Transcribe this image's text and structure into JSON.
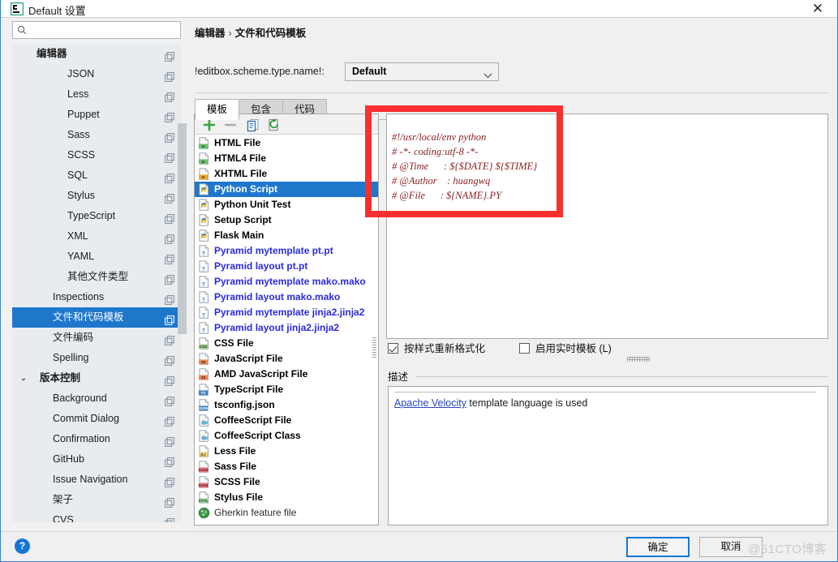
{
  "window": {
    "title": "Default 设置",
    "icon": "pycharm-icon",
    "close_label": "✕"
  },
  "sidebar": {
    "search": {
      "value": "",
      "placeholder": "",
      "icon": "search-icon"
    },
    "items": [
      {
        "label": "编辑器",
        "indent": 30,
        "bold": true,
        "selected": false,
        "caret": ""
      },
      {
        "label": "JSON",
        "indent": 68,
        "bold": false,
        "selected": false,
        "caret": ""
      },
      {
        "label": "Less",
        "indent": 68,
        "bold": false,
        "selected": false,
        "caret": ""
      },
      {
        "label": "Puppet",
        "indent": 68,
        "bold": false,
        "selected": false,
        "caret": ""
      },
      {
        "label": "Sass",
        "indent": 68,
        "bold": false,
        "selected": false,
        "caret": ""
      },
      {
        "label": "SCSS",
        "indent": 68,
        "bold": false,
        "selected": false,
        "caret": ""
      },
      {
        "label": "SQL",
        "indent": 68,
        "bold": false,
        "selected": false,
        "caret": ""
      },
      {
        "label": "Stylus",
        "indent": 68,
        "bold": false,
        "selected": false,
        "caret": ""
      },
      {
        "label": "TypeScript",
        "indent": 68,
        "bold": false,
        "selected": false,
        "caret": ""
      },
      {
        "label": "XML",
        "indent": 68,
        "bold": false,
        "selected": false,
        "caret": ""
      },
      {
        "label": "YAML",
        "indent": 68,
        "bold": false,
        "selected": false,
        "caret": ""
      },
      {
        "label": "其他文件类型",
        "indent": 68,
        "bold": false,
        "selected": false,
        "caret": ""
      },
      {
        "label": "Inspections",
        "indent": 50,
        "bold": false,
        "selected": false,
        "caret": ""
      },
      {
        "label": "文件和代码模板",
        "indent": 50,
        "bold": false,
        "selected": true,
        "caret": ""
      },
      {
        "label": "文件编码",
        "indent": 50,
        "bold": false,
        "selected": false,
        "caret": ""
      },
      {
        "label": "Spelling",
        "indent": 50,
        "bold": false,
        "selected": false,
        "caret": ""
      },
      {
        "label": "版本控制",
        "indent": 34,
        "bold": true,
        "selected": false,
        "caret": "v"
      },
      {
        "label": "Background",
        "indent": 50,
        "bold": false,
        "selected": false,
        "caret": ""
      },
      {
        "label": "Commit Dialog",
        "indent": 50,
        "bold": false,
        "selected": false,
        "caret": ""
      },
      {
        "label": "Confirmation",
        "indent": 50,
        "bold": false,
        "selected": false,
        "caret": ""
      },
      {
        "label": "GitHub",
        "indent": 50,
        "bold": false,
        "selected": false,
        "caret": ""
      },
      {
        "label": "Issue Navigation",
        "indent": 50,
        "bold": false,
        "selected": false,
        "caret": ""
      },
      {
        "label": "架子",
        "indent": 50,
        "bold": false,
        "selected": false,
        "caret": ""
      },
      {
        "label": "CVS",
        "indent": 50,
        "bold": false,
        "selected": false,
        "caret": ""
      }
    ]
  },
  "header": {
    "breadcrumb_parent": "编辑器",
    "breadcrumb_sep": "›",
    "breadcrumb_current": "文件和代码模板",
    "scheme_label": "!editbox.scheme.type.name!:",
    "scheme_value": "Default"
  },
  "tabs": [
    {
      "label": "模板",
      "active": true
    },
    {
      "label": "包含",
      "active": false
    },
    {
      "label": "代码",
      "active": false
    }
  ],
  "filelist": {
    "toolbar": [
      {
        "name": "add-template-button",
        "icon": "plus-icon"
      },
      {
        "name": "remove-template-button",
        "icon": "minus-icon"
      },
      {
        "name": "copy-template-button",
        "icon": "copy-icon"
      },
      {
        "name": "reset-template-button",
        "icon": "reset-icon"
      }
    ],
    "items": [
      {
        "label": "HTML File",
        "icon": "html-file-icon",
        "style": "bold",
        "selected": false
      },
      {
        "label": "HTML4 File",
        "icon": "html-file-icon",
        "style": "bold",
        "selected": false
      },
      {
        "label": "XHTML File",
        "icon": "xhtml-file-icon",
        "style": "bold",
        "selected": false
      },
      {
        "label": "Python Script",
        "icon": "python-file-icon",
        "style": "bold",
        "selected": true
      },
      {
        "label": "Python Unit Test",
        "icon": "python-file-icon",
        "style": "bold",
        "selected": false
      },
      {
        "label": "Setup Script",
        "icon": "python-file-icon",
        "style": "bold",
        "selected": false
      },
      {
        "label": "Flask Main",
        "icon": "python-file-icon",
        "style": "bold",
        "selected": false
      },
      {
        "label": "Pyramid mytemplate pt.pt",
        "icon": "unknown-file-icon",
        "style": "blue",
        "selected": false
      },
      {
        "label": "Pyramid layout pt.pt",
        "icon": "unknown-file-icon",
        "style": "blue",
        "selected": false
      },
      {
        "label": "Pyramid mytemplate mako.mako",
        "icon": "unknown-file-icon",
        "style": "blue",
        "selected": false
      },
      {
        "label": "Pyramid layout mako.mako",
        "icon": "unknown-file-icon",
        "style": "blue",
        "selected": false
      },
      {
        "label": "Pyramid mytemplate jinja2.jinja2",
        "icon": "unknown-file-icon",
        "style": "blue",
        "selected": false
      },
      {
        "label": "Pyramid layout jinja2.jinja2",
        "icon": "unknown-file-icon",
        "style": "blue",
        "selected": false
      },
      {
        "label": "CSS File",
        "icon": "css-file-icon",
        "style": "bold",
        "selected": false
      },
      {
        "label": "JavaScript File",
        "icon": "js-file-icon",
        "style": "bold",
        "selected": false
      },
      {
        "label": "AMD JavaScript File",
        "icon": "js-file-icon",
        "style": "bold",
        "selected": false
      },
      {
        "label": "TypeScript File",
        "icon": "ts-file-icon",
        "style": "bold",
        "selected": false
      },
      {
        "label": "tsconfig.json",
        "icon": "json-file-icon",
        "style": "bold",
        "selected": false
      },
      {
        "label": "CoffeeScript File",
        "icon": "coffee-file-icon",
        "style": "bold",
        "selected": false
      },
      {
        "label": "CoffeeScript Class",
        "icon": "coffee-file-icon",
        "style": "bold",
        "selected": false
      },
      {
        "label": "Less File",
        "icon": "less-file-icon",
        "style": "bold",
        "selected": false
      },
      {
        "label": "Sass File",
        "icon": "sass-file-icon",
        "style": "bold",
        "selected": false
      },
      {
        "label": "SCSS File",
        "icon": "sass-file-icon",
        "style": "bold",
        "selected": false
      },
      {
        "label": "Stylus File",
        "icon": "stylus-file-icon",
        "style": "bold",
        "selected": false
      },
      {
        "label": "Gherkin feature file",
        "icon": "gherkin-file-icon",
        "style": "plain",
        "selected": false
      }
    ]
  },
  "editor": {
    "code_lines": [
      "#!/usr/local/env python",
      "# -*- coding:utf-8 -*-",
      "# @Time      : ${$DATE} ${$TIME}",
      "# @Author    : huangwq",
      "# @File      : ${NAME}.PY"
    ],
    "code_text": "#!/usr/local/env python\n# -*- coding:utf-8 -*-\n# @Time      : ${$DATE} ${$TIME}\n# @Author    : huangwq\n# @File      : ${NAME}.PY"
  },
  "options": {
    "reformat_label": "按样式重新格式化",
    "reformat_checked": true,
    "live_template_label": "启用实时模板 (L)",
    "live_template_mnemonic": "L",
    "live_template_checked": false
  },
  "description": {
    "legend": "描述",
    "link_text": "Apache Velocity",
    "rest_text": " template language is used"
  },
  "footer": {
    "help_label": "?",
    "ok_label": "确定",
    "cancel_label": "取消",
    "watermark": "@51CTO博客"
  },
  "colors": {
    "accent": "#1f77cc",
    "annotation": "#f92f2f",
    "code": "#8a2222",
    "link": "#2b45c4",
    "blue_item": "#2a2ae0"
  }
}
